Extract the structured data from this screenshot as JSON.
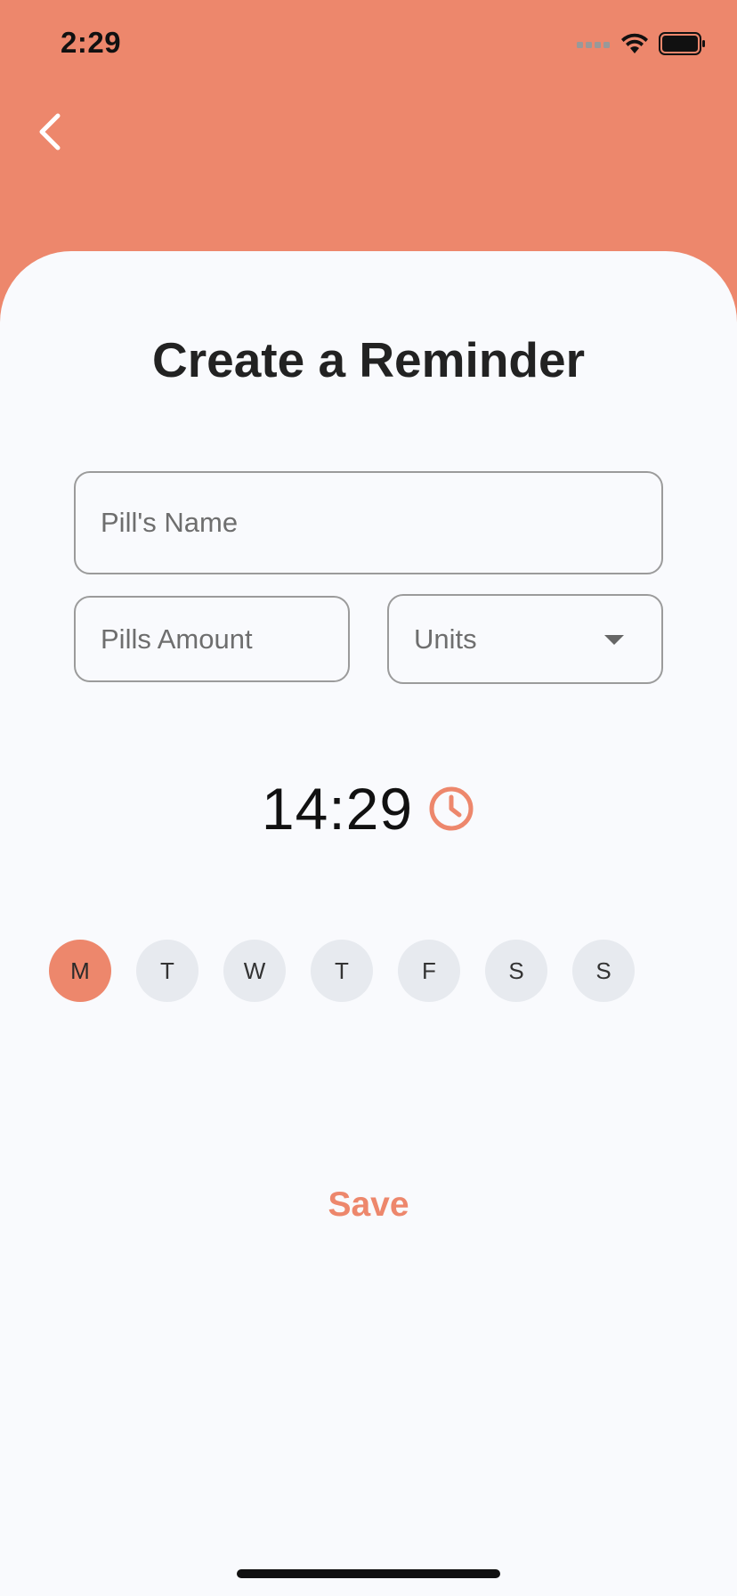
{
  "status_bar": {
    "time": "2:29",
    "icons": [
      "signal-icon",
      "wifi-icon",
      "battery-icon"
    ]
  },
  "header": {
    "back_icon": "chevron-left-icon"
  },
  "page": {
    "title": "Create a Reminder"
  },
  "form": {
    "pill_name": {
      "value": "",
      "placeholder": "Pill's Name"
    },
    "pills_amount": {
      "value": "",
      "placeholder": "Pills Amount"
    },
    "units": {
      "selected": "Units",
      "icon": "caret-down-icon"
    }
  },
  "reminder_time": {
    "value": "14:29",
    "icon": "clock-icon"
  },
  "weekdays": [
    {
      "label": "M",
      "selected": true
    },
    {
      "label": "T",
      "selected": false
    },
    {
      "label": "W",
      "selected": false
    },
    {
      "label": "T",
      "selected": false
    },
    {
      "label": "F",
      "selected": false
    },
    {
      "label": "S",
      "selected": false
    },
    {
      "label": "S",
      "selected": false
    }
  ],
  "actions": {
    "save_label": "Save"
  },
  "colors": {
    "accent": "#ED876C",
    "sheet_background": "#F9FAFD",
    "day_inactive": "#E7EAEF"
  }
}
